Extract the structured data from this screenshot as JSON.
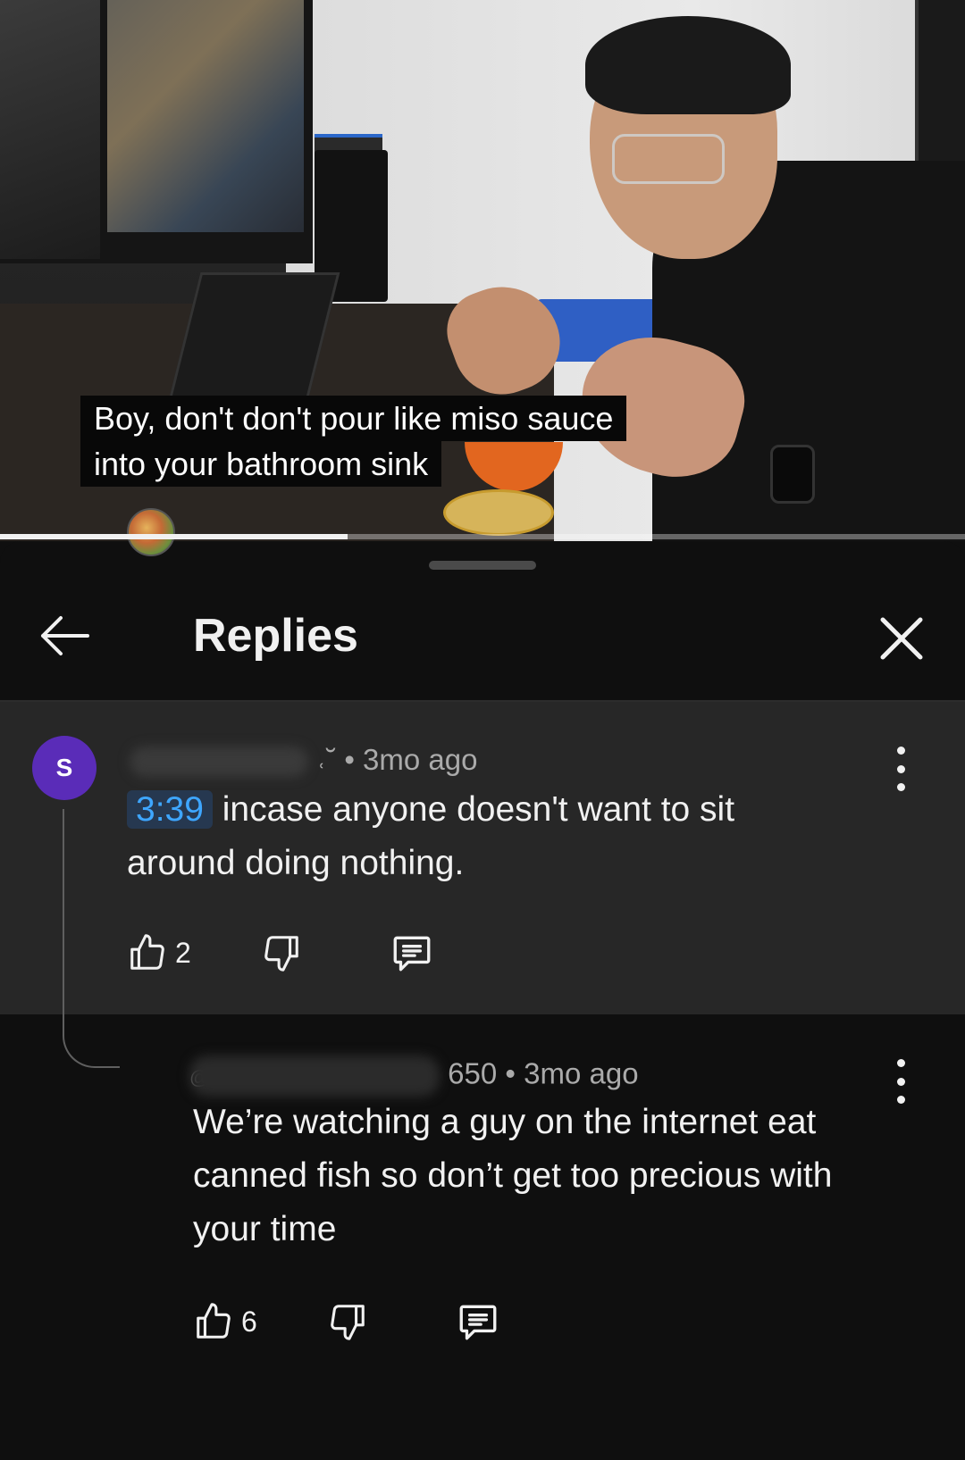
{
  "video": {
    "caption_line1": "Boy, don't don't pour like miso sauce",
    "caption_line2": "into your bathroom sink",
    "progress_fraction": 0.36
  },
  "panel": {
    "title": "Replies"
  },
  "parent_comment": {
    "avatar_letter": "S",
    "author_tail": "˓˘",
    "meta": "• 3mo ago",
    "timestamp": "3:39",
    "text_after_timestamp": " incase anyone doesn't want to sit",
    "text_line2": "around doing nothing.",
    "likes": "2"
  },
  "reply_comment": {
    "author_prefix": "@",
    "author_tail": "650",
    "meta": "• 3mo ago",
    "text": "We’re watching a guy on the internet eat canned fish so don’t get too precious with your time",
    "likes": "6"
  },
  "icons": {
    "back": "arrow-left-icon",
    "close": "close-icon",
    "like": "thumbs-up-icon",
    "dislike": "thumbs-down-icon",
    "reply": "comment-icon",
    "more": "more-vertical-icon"
  },
  "colors": {
    "timestamp_link": "#3ea6ff",
    "timestamp_bg": "#263850",
    "avatar": "#5a2cb8",
    "panel_bg": "#0f0f0f",
    "highlight_bg": "#272727"
  }
}
